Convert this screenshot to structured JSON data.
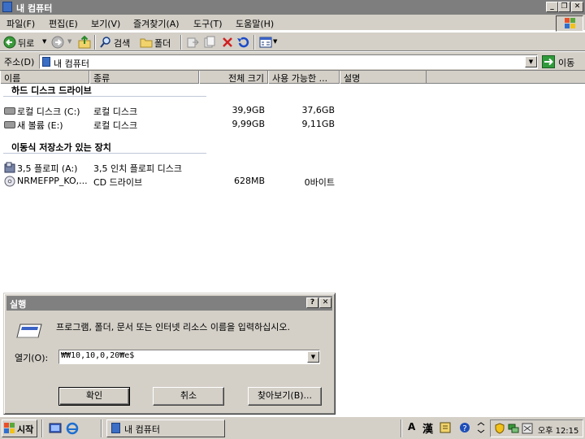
{
  "window": {
    "title": "내 컴퓨터",
    "minimize_glyph": "_",
    "restore_glyph": "❐",
    "close_glyph": "✕"
  },
  "menu": [
    {
      "label": "파일(F)"
    },
    {
      "label": "편집(E)"
    },
    {
      "label": "보기(V)"
    },
    {
      "label": "즐겨찾기(A)"
    },
    {
      "label": "도구(T)"
    },
    {
      "label": "도움말(H)"
    }
  ],
  "toolbar": {
    "back": "뒤로",
    "search": "검색",
    "folders": "폴더"
  },
  "address": {
    "label": "주소(D)",
    "value": "내 컴퓨터",
    "go": "이동"
  },
  "columns": [
    {
      "label": "이름"
    },
    {
      "label": "종류"
    },
    {
      "label": "전체 크기"
    },
    {
      "label": "사용 가능한 ..."
    },
    {
      "label": "설명"
    }
  ],
  "groups": {
    "hdd": {
      "title": "하드 디스크 드라이브",
      "items": [
        {
          "name": "로컬 디스크 (C:)",
          "type": "로컬 디스크",
          "total": "39,9GB",
          "free": "37,6GB"
        },
        {
          "name": "새 볼륨 (E:)",
          "type": "로컬 디스크",
          "total": "9,99GB",
          "free": "9,11GB"
        }
      ]
    },
    "removable": {
      "title": "이동식 저장소가 있는 장치",
      "items": [
        {
          "name": "3,5 플로피 (A:)",
          "type": "3,5 인치 플로피 디스크",
          "total": "",
          "free": ""
        },
        {
          "name": "NRMEFPP_KO,...",
          "type": "CD 드라이브",
          "total": "628MB",
          "free": "0바이트"
        }
      ]
    }
  },
  "run_dialog": {
    "title": "실행",
    "help_glyph": "?",
    "close_glyph": "✕",
    "description": "프로그램, 폴더, 문서 또는 인터넷 리소스 이름을 입력하십시오.",
    "open_label": "열기(O):",
    "input_value": "₩₩10,10,0,20₩e$",
    "ok": "확인",
    "cancel": "취소",
    "browse": "찾아보기(B)..."
  },
  "taskbar": {
    "start": "시작",
    "task_title": "내 컴퓨터",
    "ime_a": "A",
    "ime_han": "漢",
    "clock": "오후 12:15"
  }
}
